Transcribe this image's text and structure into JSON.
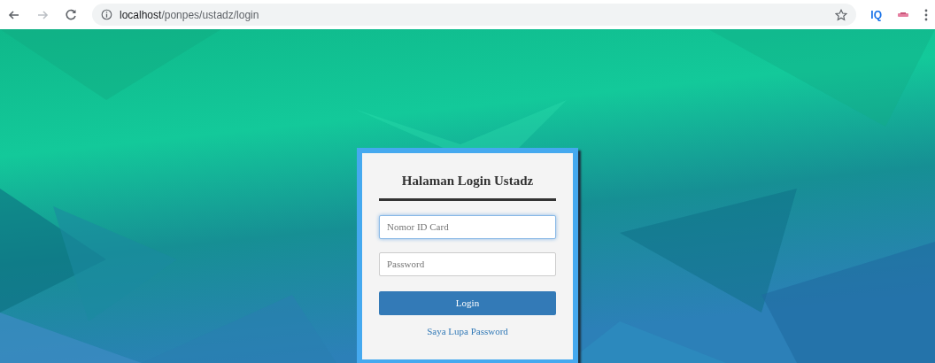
{
  "browser": {
    "url_host": "localhost",
    "url_path": "/ponpes/ustadz/login",
    "extension_label": "IQ"
  },
  "login": {
    "title": "Halaman Login Ustadz",
    "fields": [
      {
        "placeholder": "Nomor ID Card",
        "focused": true
      },
      {
        "placeholder": "Password",
        "focused": false
      }
    ],
    "button": "Login",
    "link": "Saya Lupa Password"
  }
}
